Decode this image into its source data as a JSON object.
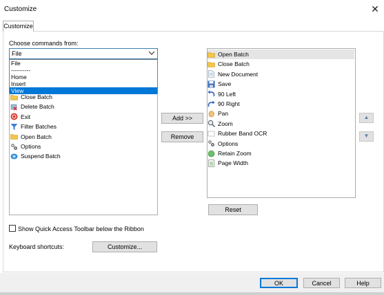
{
  "window": {
    "title": "Customize",
    "close_glyph": "✕"
  },
  "tab": {
    "label": "Customize"
  },
  "choose": {
    "label": "Choose commands from:",
    "selected": "File",
    "options": [
      "File",
      "----------",
      "Home",
      "Insert",
      "View"
    ],
    "highlighted": "View"
  },
  "left_list": [
    {
      "label": "Close Batch",
      "icon": "folder-icon"
    },
    {
      "label": "Delete Batch",
      "icon": "delete-batch-icon"
    },
    {
      "label": "Exit",
      "icon": "exit-icon"
    },
    {
      "label": "Filter Batches",
      "icon": "filter-icon"
    },
    {
      "label": "Open Batch",
      "icon": "folder-icon"
    },
    {
      "label": "Options",
      "icon": "options-icon"
    },
    {
      "label": "Suspend Batch",
      "icon": "suspend-icon"
    }
  ],
  "buttons": {
    "add": "Add >>",
    "remove": "Remove",
    "reset": "Reset",
    "customize": "Customize...",
    "ok": "OK",
    "cancel": "Cancel",
    "help": "Help"
  },
  "right_list": [
    {
      "label": "Open Batch",
      "icon": "folder-icon",
      "selected": true
    },
    {
      "label": "Close Batch",
      "icon": "folder-icon"
    },
    {
      "label": "New Document",
      "icon": "document-icon"
    },
    {
      "label": "Save",
      "icon": "save-icon"
    },
    {
      "label": "90 Left",
      "icon": "rotate-left-icon"
    },
    {
      "label": "90 Right",
      "icon": "rotate-right-icon"
    },
    {
      "label": "Pan",
      "icon": "pan-icon"
    },
    {
      "label": "Zoom",
      "icon": "zoom-icon"
    },
    {
      "label": "Rubber Band OCR",
      "icon": "ocr-icon"
    },
    {
      "label": "Options",
      "icon": "options-icon"
    },
    {
      "label": "Retain Zoom",
      "icon": "retain-zoom-icon"
    },
    {
      "label": "Page Width",
      "icon": "page-width-icon"
    }
  ],
  "move_up_glyph": "▲",
  "move_down_glyph": "▼",
  "checkbox": {
    "label": "Show Quick Access Toolbar below the Ribbon",
    "checked": false
  },
  "shortcuts": {
    "label": "Keyboard shortcuts:"
  },
  "colors": {
    "accent": "#0078d7",
    "selection": "#0078d7"
  }
}
